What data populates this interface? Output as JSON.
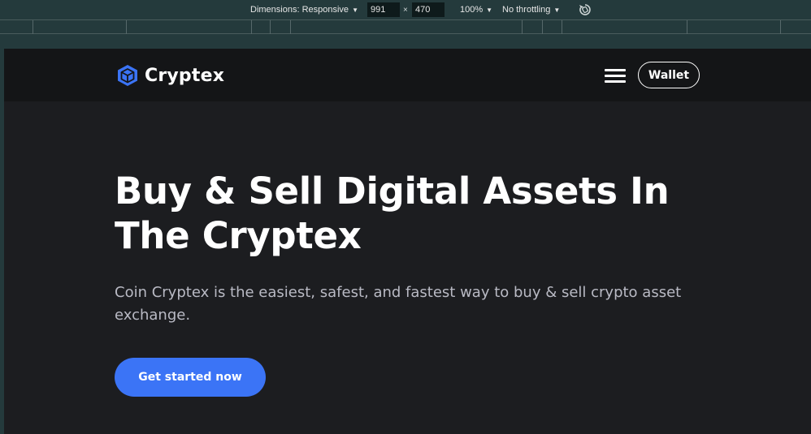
{
  "devtools": {
    "dimensions_label": "Dimensions: Responsive",
    "width_value": "991",
    "times_sign": "×",
    "height_value": "470",
    "zoom_label": "100%",
    "throttling_label": "No throttling",
    "rotate_icon": "rotate-icon"
  },
  "header": {
    "brand_name": "Cryptex",
    "logo_icon": "cube-icon",
    "menu_icon": "hamburger-menu-icon",
    "wallet_label": "Wallet"
  },
  "hero": {
    "title_line1": "Buy & Sell Digital Assets In",
    "title_line2": "The Cryptex",
    "subtitle_line1": "Coin Cryptex is the easiest, safest, and fastest way to buy & sell crypto asset",
    "subtitle_line2": "exchange.",
    "cta_label": "Get started now"
  },
  "colors": {
    "page_background": "#1c1d20",
    "header_background": "#141517",
    "accent": "#3b74f6",
    "subtitle_text": "#b9bac4",
    "devtools_background": "#243a3c"
  }
}
